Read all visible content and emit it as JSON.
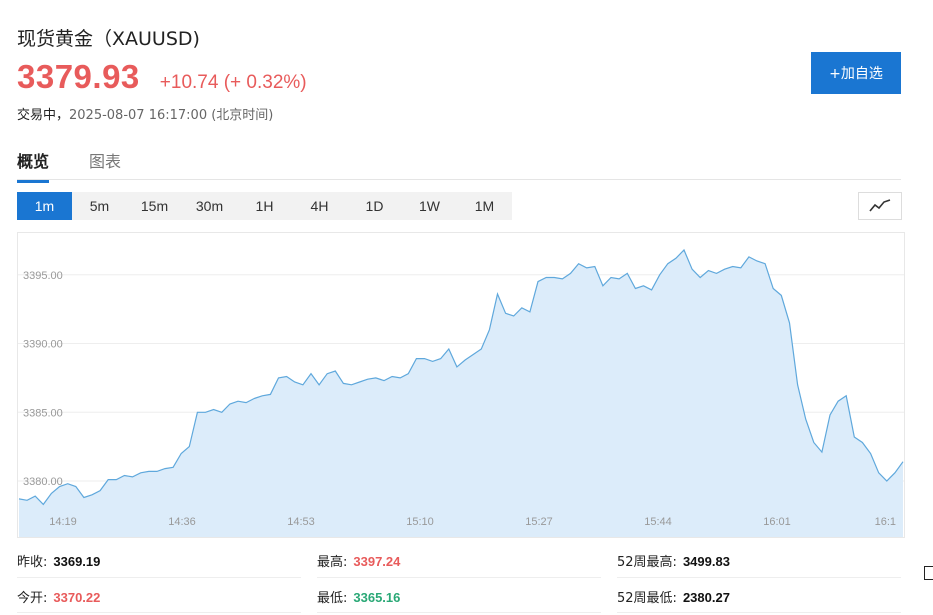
{
  "header": {
    "title": "现货黄金（XAUUSD)",
    "price": "3379.93",
    "change": "+10.74 (+ 0.32%)",
    "status_prefix": "交易中，",
    "timestamp": "2025-08-07 16:17:00 (北京时间)",
    "watch_button": "+加自选"
  },
  "tabs": [
    {
      "label": "概览",
      "active": true
    },
    {
      "label": "图表",
      "active": false
    }
  ],
  "intervals": [
    "1m",
    "5m",
    "15m",
    "30m",
    "1H",
    "4H",
    "1D",
    "1W",
    "1M"
  ],
  "active_interval": "1m",
  "chart_type_icon": "line-chart-icon",
  "colors": {
    "up": "#e85b5b",
    "down": "#2aa876",
    "accent": "#1a76d2",
    "line": "#5fa8dc",
    "fill": "#dcecfa"
  },
  "chart_data": {
    "type": "area",
    "ylim": [
      3378.0,
      3398.0
    ],
    "yticks": [
      "3380.00",
      "3385.00",
      "3390.00",
      "3395.00"
    ],
    "xticks": [
      "14:19",
      "14:36",
      "14:53",
      "15:10",
      "15:27",
      "15:44",
      "16:01",
      "16:1"
    ],
    "x_range": [
      "14:16",
      "16:17"
    ],
    "values": [
      3378.7,
      3378.6,
      3378.9,
      3378.3,
      3379.1,
      3379.6,
      3379.8,
      3379.6,
      3378.8,
      3379.0,
      3379.3,
      3380.1,
      3380.1,
      3380.4,
      3380.3,
      3380.6,
      3380.7,
      3380.7,
      3380.9,
      3381.0,
      3382.0,
      3382.5,
      3385.0,
      3385.0,
      3385.2,
      3385.0,
      3385.6,
      3385.8,
      3385.7,
      3386.0,
      3386.2,
      3386.3,
      3387.5,
      3387.6,
      3387.2,
      3387.0,
      3387.8,
      3387.0,
      3387.8,
      3388.0,
      3387.1,
      3387.0,
      3387.2,
      3387.4,
      3387.5,
      3387.3,
      3387.6,
      3387.5,
      3387.8,
      3388.9,
      3388.9,
      3388.7,
      3388.9,
      3389.6,
      3388.3,
      3388.8,
      3389.2,
      3389.6,
      3391.0,
      3393.6,
      3392.2,
      3392.0,
      3392.6,
      3392.3,
      3394.5,
      3394.8,
      3394.8,
      3394.7,
      3395.1,
      3395.8,
      3395.5,
      3395.6,
      3394.2,
      3394.8,
      3394.7,
      3395.1,
      3394.0,
      3394.2,
      3393.9,
      3395.0,
      3395.8,
      3396.2,
      3396.8,
      3395.4,
      3394.8,
      3395.3,
      3395.1,
      3395.4,
      3395.6,
      3395.5,
      3396.3,
      3396.0,
      3395.8,
      3394.0,
      3393.5,
      3391.5,
      3387.0,
      3384.5,
      3382.8,
      3382.1,
      3384.8,
      3385.8,
      3386.2,
      3383.2,
      3382.8,
      3382.0,
      3380.6,
      3380.0,
      3380.6,
      3381.4
    ]
  },
  "stats": {
    "prev_close_label": "昨收:",
    "prev_close": "3369.19",
    "open_label": "今开:",
    "open": "3370.22",
    "high_label": "最高:",
    "high": "3397.24",
    "low_label": "最低:",
    "low": "3365.16",
    "high52_label": "52周最高:",
    "high52": "3499.83",
    "low52_label": "52周最低:",
    "low52": "2380.27"
  }
}
